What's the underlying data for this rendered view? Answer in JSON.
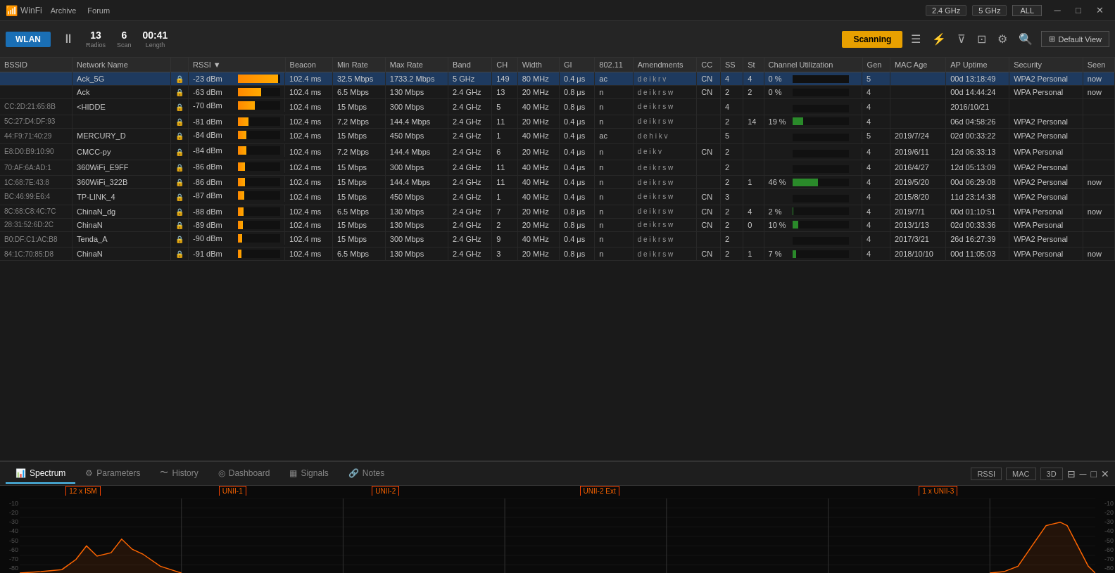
{
  "titlebar": {
    "brand": "WinFi",
    "nav": [
      "Archive",
      "Forum"
    ],
    "freq_2g": "2.4 GHz",
    "freq_5g": "5 GHz",
    "freq_all": "ALL",
    "win_minimize": "─",
    "win_maximize": "□",
    "win_close": "✕"
  },
  "toolbar": {
    "wlan_label": "WLAN",
    "radios_value": "13",
    "radios_label": "Radios",
    "scan_value": "6",
    "scan_label": "Scan",
    "length_value": "00:41",
    "length_label": "Length",
    "scanning_label": "Scanning",
    "default_view_label": "Default View"
  },
  "table": {
    "columns": [
      "BSSID",
      "Network Name",
      "",
      "RSSI",
      "Beacon",
      "Min Rate",
      "Max Rate",
      "Band",
      "CH",
      "Width",
      "GI",
      "802.11",
      "Amendments",
      "CC",
      "SS",
      "St",
      "Channel Utilization",
      "Gen",
      "MAC Age",
      "AP Uptime",
      "Security",
      "Seen"
    ],
    "rows": [
      {
        "bssid": "",
        "network": "Ack_5G",
        "locked": true,
        "rssi": "-23 dBm",
        "rssi_pct": 95,
        "beacon": "102.4 ms",
        "min_rate": "32.5 Mbps",
        "max_rate": "1733.2 Mbps",
        "band": "5 GHz",
        "ch": "149",
        "width": "80 MHz",
        "gi": "0.4 μs",
        "dot11": "ac",
        "amendments": "d e i k r v",
        "cc": "CN",
        "ss": "4",
        "st": "4",
        "util_pct": 0,
        "util_label": "0 %",
        "gen": "5",
        "mac_age": "",
        "ap_uptime": "00d 13:18:49",
        "security": "WPA2 Personal",
        "seen": "now",
        "selected": true
      },
      {
        "bssid": "",
        "network": "Ack",
        "locked": true,
        "rssi": "-63 dBm",
        "rssi_pct": 55,
        "beacon": "102.4 ms",
        "min_rate": "6.5 Mbps",
        "max_rate": "130 Mbps",
        "band": "2.4 GHz",
        "ch": "13",
        "width": "20 MHz",
        "gi": "0.8 μs",
        "dot11": "n",
        "amendments": "d e i k r s w",
        "cc": "CN",
        "ss": "2",
        "st": "2",
        "util_pct": 0,
        "util_label": "0 %",
        "gen": "4",
        "mac_age": "",
        "ap_uptime": "00d 14:44:24",
        "security": "WPA Personal",
        "seen": "now",
        "selected": false
      },
      {
        "bssid": "CC:2D:21:65:8B",
        "network": "<HIDDE",
        "locked": true,
        "rssi": "-70 dBm",
        "rssi_pct": 40,
        "beacon": "102.4 ms",
        "min_rate": "15 Mbps",
        "max_rate": "300 Mbps",
        "band": "2.4 GHz",
        "ch": "5",
        "width": "40 MHz",
        "gi": "0.8 μs",
        "dot11": "n",
        "amendments": "d e i k r s w",
        "cc": "",
        "ss": "4",
        "st": "",
        "util_pct": 0,
        "util_label": "",
        "gen": "4",
        "mac_age": "",
        "ap_uptime": "2016/10/21",
        "security": "",
        "seen": "",
        "selected": false
      },
      {
        "bssid": "5C:27:D4:DF:93",
        "network": "",
        "locked": true,
        "rssi": "-81 dBm",
        "rssi_pct": 25,
        "beacon": "102.4 ms",
        "min_rate": "7.2 Mbps",
        "max_rate": "144.4 Mbps",
        "band": "2.4 GHz",
        "ch": "11",
        "width": "20 MHz",
        "gi": "0.4 μs",
        "dot11": "n",
        "amendments": "d e i k r s w",
        "cc": "",
        "ss": "2",
        "st": "14",
        "util_pct": 19,
        "util_label": "19 %",
        "gen": "4",
        "mac_age": "",
        "ap_uptime": "06d 04:58:26",
        "security": "WPA2 Personal",
        "seen": "",
        "selected": false
      },
      {
        "bssid": "44:F9:71:40:29",
        "network": "MERCURY_D",
        "locked": true,
        "rssi": "-84 dBm",
        "rssi_pct": 20,
        "beacon": "102.4 ms",
        "min_rate": "15 Mbps",
        "max_rate": "450 Mbps",
        "band": "2.4 GHz",
        "ch": "1",
        "width": "40 MHz",
        "gi": "0.4 μs",
        "dot11": "ac",
        "amendments": "d e h i k v",
        "cc": "",
        "ss": "5",
        "st": "",
        "util_pct": 0,
        "util_label": "",
        "gen": "5",
        "mac_age": "2019/7/24",
        "ap_uptime": "02d 00:33:22",
        "security": "WPA2 Personal",
        "seen": "",
        "selected": false
      },
      {
        "bssid": "E8:D0:B9:10:90",
        "network": "CMCC-py",
        "locked": true,
        "rssi": "-84 dBm",
        "rssi_pct": 20,
        "beacon": "102.4 ms",
        "min_rate": "7.2 Mbps",
        "max_rate": "144.4 Mbps",
        "band": "2.4 GHz",
        "ch": "6",
        "width": "20 MHz",
        "gi": "0.4 μs",
        "dot11": "n",
        "amendments": "d e i k v",
        "cc": "CN",
        "ss": "2",
        "st": "",
        "util_pct": 0,
        "util_label": "",
        "gen": "4",
        "mac_age": "2019/6/11",
        "ap_uptime": "12d 06:33:13",
        "security": "WPA Personal",
        "seen": "",
        "selected": false
      },
      {
        "bssid": "70:AF:6A:AD:1",
        "network": "360WiFi_E9FF",
        "locked": true,
        "rssi": "-86 dBm",
        "rssi_pct": 17,
        "beacon": "102.4 ms",
        "min_rate": "15 Mbps",
        "max_rate": "300 Mbps",
        "band": "2.4 GHz",
        "ch": "11",
        "width": "40 MHz",
        "gi": "0.4 μs",
        "dot11": "n",
        "amendments": "d e i k r s w",
        "cc": "",
        "ss": "2",
        "st": "",
        "util_pct": 0,
        "util_label": "",
        "gen": "4",
        "mac_age": "2016/4/27",
        "ap_uptime": "12d 05:13:09",
        "security": "WPA2 Personal",
        "seen": "",
        "selected": false
      },
      {
        "bssid": "1C:68:7E:43:8",
        "network": "360WiFi_322B",
        "locked": true,
        "rssi": "-86 dBm",
        "rssi_pct": 17,
        "beacon": "102.4 ms",
        "min_rate": "15 Mbps",
        "max_rate": "144.4 Mbps",
        "band": "2.4 GHz",
        "ch": "11",
        "width": "40 MHz",
        "gi": "0.4 μs",
        "dot11": "n",
        "amendments": "d e i k r s w",
        "cc": "",
        "ss": "2",
        "st": "1",
        "util_pct": 46,
        "util_label": "46 %",
        "gen": "4",
        "mac_age": "2019/5/20",
        "ap_uptime": "00d 06:29:08",
        "security": "WPA2 Personal",
        "seen": "now",
        "selected": false
      },
      {
        "bssid": "BC:46:99:E6:4",
        "network": "TP-LINK_4",
        "locked": true,
        "rssi": "-87 dBm",
        "rssi_pct": 15,
        "beacon": "102.4 ms",
        "min_rate": "15 Mbps",
        "max_rate": "450 Mbps",
        "band": "2.4 GHz",
        "ch": "1",
        "width": "40 MHz",
        "gi": "0.4 μs",
        "dot11": "n",
        "amendments": "d e i k r s w",
        "cc": "CN",
        "ss": "3",
        "st": "",
        "util_pct": 0,
        "util_label": "",
        "gen": "4",
        "mac_age": "2015/8/20",
        "ap_uptime": "11d 23:14:38",
        "security": "WPA2 Personal",
        "seen": "",
        "selected": false
      },
      {
        "bssid": "8C:68:C8:4C:7C",
        "network": "ChinaN_dg",
        "locked": true,
        "rssi": "-88 dBm",
        "rssi_pct": 13,
        "beacon": "102.4 ms",
        "min_rate": "6.5 Mbps",
        "max_rate": "130 Mbps",
        "band": "2.4 GHz",
        "ch": "7",
        "width": "20 MHz",
        "gi": "0.8 μs",
        "dot11": "n",
        "amendments": "d e i k r s w",
        "cc": "CN",
        "ss": "2",
        "st": "4",
        "util_pct": 2,
        "util_label": "2 %",
        "gen": "4",
        "mac_age": "2019/7/1",
        "ap_uptime": "00d 01:10:51",
        "security": "WPA Personal",
        "seen": "now",
        "selected": false
      },
      {
        "bssid": "28:31:52:6D:2C",
        "network": "ChinaN",
        "locked": true,
        "rssi": "-89 dBm",
        "rssi_pct": 12,
        "beacon": "102.4 ms",
        "min_rate": "15 Mbps",
        "max_rate": "130 Mbps",
        "band": "2.4 GHz",
        "ch": "2",
        "width": "20 MHz",
        "gi": "0.8 μs",
        "dot11": "n",
        "amendments": "d e i k r s w",
        "cc": "CN",
        "ss": "2",
        "st": "0",
        "util_pct": 10,
        "util_label": "10 %",
        "gen": "4",
        "mac_age": "2013/1/13",
        "ap_uptime": "02d 00:33:36",
        "security": "WPA Personal",
        "seen": "",
        "selected": false
      },
      {
        "bssid": "B0:DF:C1:AC:B8",
        "network": "Tenda_A",
        "locked": true,
        "rssi": "-90 dBm",
        "rssi_pct": 10,
        "beacon": "102.4 ms",
        "min_rate": "15 Mbps",
        "max_rate": "300 Mbps",
        "band": "2.4 GHz",
        "ch": "9",
        "width": "40 MHz",
        "gi": "0.4 μs",
        "dot11": "n",
        "amendments": "d e i k r s w",
        "cc": "",
        "ss": "2",
        "st": "",
        "util_pct": 0,
        "util_label": "",
        "gen": "4",
        "mac_age": "2017/3/21",
        "ap_uptime": "26d 16:27:39",
        "security": "WPA2 Personal",
        "seen": "",
        "selected": false
      },
      {
        "bssid": "84:1C:70:85:D8",
        "network": "ChinaN",
        "locked": true,
        "rssi": "-91 dBm",
        "rssi_pct": 8,
        "beacon": "102.4 ms",
        "min_rate": "6.5 Mbps",
        "max_rate": "130 Mbps",
        "band": "2.4 GHz",
        "ch": "3",
        "width": "20 MHz",
        "gi": "0.8 μs",
        "dot11": "n",
        "amendments": "d e i k r s w",
        "cc": "CN",
        "ss": "2",
        "st": "1",
        "util_pct": 7,
        "util_label": "7 %",
        "gen": "4",
        "mac_age": "2018/10/10",
        "ap_uptime": "00d 11:05:03",
        "security": "WPA Personal",
        "seen": "now",
        "selected": false
      }
    ]
  },
  "bottom_panel": {
    "tabs": [
      {
        "id": "spectrum",
        "label": "Spectrum",
        "icon": "📊",
        "active": true
      },
      {
        "id": "parameters",
        "label": "Parameters",
        "icon": "⚙",
        "active": false
      },
      {
        "id": "history",
        "label": "History",
        "icon": "〜",
        "active": false
      },
      {
        "id": "dashboard",
        "label": "Dashboard",
        "icon": "◎",
        "active": false
      },
      {
        "id": "signals",
        "label": "Signals",
        "icon": "▦",
        "active": false
      },
      {
        "id": "notes",
        "label": "Notes",
        "icon": "🔗",
        "active": false
      }
    ],
    "controls": {
      "rssi_label": "RSSI",
      "mac_label": "MAC",
      "three_d_label": "3D"
    },
    "spectrum_bands": [
      {
        "label": "12 x ISM",
        "left_pct": 7,
        "width_pct": 11
      },
      {
        "label": "UNII-1",
        "left_pct": 20,
        "width_pct": 12
      },
      {
        "label": "UNII-2",
        "left_pct": 34,
        "width_pct": 12
      },
      {
        "label": "UNII-2 Ext",
        "left_pct": 53,
        "width_pct": 14
      },
      {
        "label": "1 x UNII-3",
        "left_pct": 84,
        "width_pct": 11
      }
    ],
    "y_axis_labels": [
      "-10",
      "-20",
      "-30",
      "-40",
      "-50",
      "-60",
      "-70",
      "-80"
    ],
    "y_axis_labels_right": [
      "-10",
      "-20",
      "-30",
      "-40",
      "-50",
      "-60",
      "-70",
      "-80"
    ]
  }
}
